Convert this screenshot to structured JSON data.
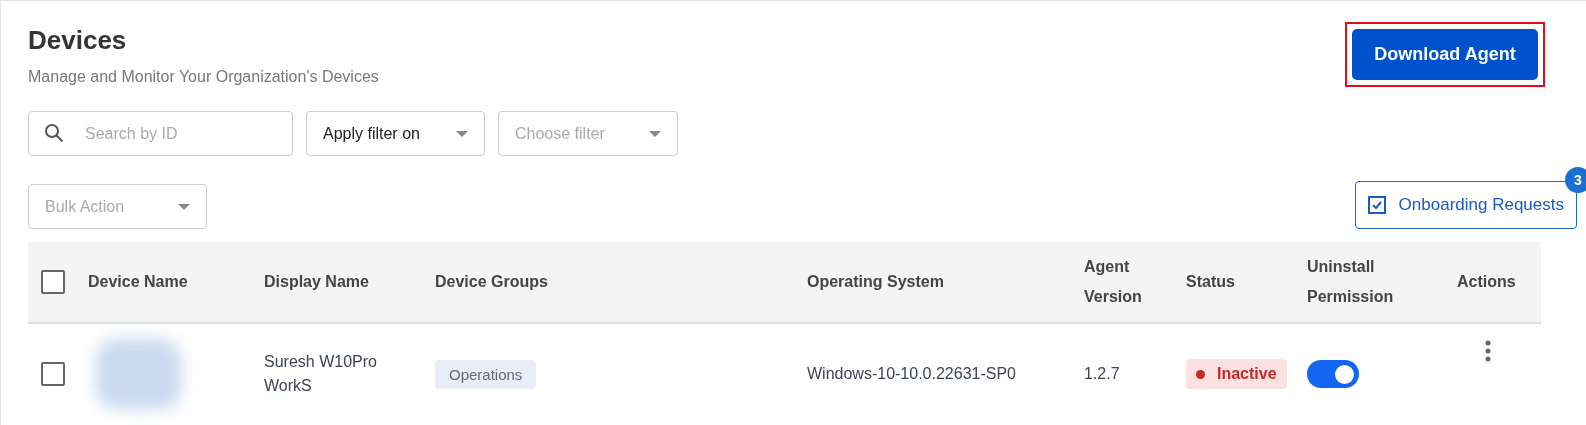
{
  "header": {
    "title": "Devices",
    "subtitle": "Manage and Monitor Your Organization's Devices"
  },
  "download_button": {
    "label": "Download Agent",
    "highlighted": true
  },
  "filters": {
    "search": {
      "placeholder": "Search by ID"
    },
    "apply_filter": {
      "label": "Apply filter on",
      "disabled": false
    },
    "choose_filter": {
      "label": "Choose filter",
      "disabled": true
    }
  },
  "bulk_action": {
    "label": "Bulk Action",
    "disabled": true
  },
  "onboarding_button": {
    "label": "Onboarding Requests",
    "badge": "3"
  },
  "table": {
    "select_all": {
      "checked": false
    },
    "columns": [
      "Device Name",
      "Display Name",
      "Device Groups",
      "Operating System",
      "Agent Version",
      "Status",
      "Uninstall Permission",
      "Actions"
    ],
    "rows": [
      {
        "checked": false,
        "display_name": "Suresh W10Pro WorkS",
        "group": "Operations",
        "os": "Windows-10-10.0.22631-SP0",
        "agent_version": "1.2.7",
        "status": "Inactive",
        "active": false,
        "uninstall_permission": true
      }
    ]
  }
}
